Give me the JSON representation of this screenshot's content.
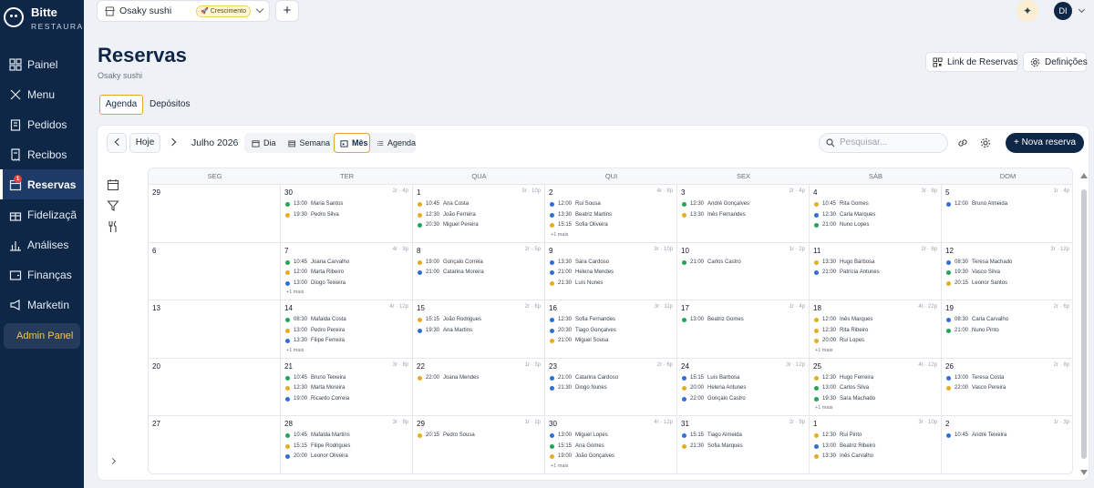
{
  "sidebar": {
    "brand": "Bitte",
    "brand_sub": "RESTAURA",
    "items": [
      {
        "label": "Painel",
        "icon": "grid-icon"
      },
      {
        "label": "Menu",
        "icon": "utensils-icon"
      },
      {
        "label": "Pedidos",
        "icon": "clipboard-icon"
      },
      {
        "label": "Recibos",
        "icon": "receipt-icon"
      },
      {
        "label": "Reservas",
        "icon": "calendar-icon",
        "badge": "1"
      },
      {
        "label": "Fidelizaçã",
        "icon": "gift-icon"
      },
      {
        "label": "Análises",
        "icon": "bar-chart-icon"
      },
      {
        "label": "Finanças",
        "icon": "wallet-icon"
      },
      {
        "label": "Marketin",
        "icon": "megaphone-icon"
      }
    ],
    "admin_label": "Admin Panel"
  },
  "topbar": {
    "restaurant": "Osaky sushi",
    "plan_badge": "🚀 Crescimento",
    "add_label": "+",
    "avatar": "DI"
  },
  "header": {
    "title": "Reservas",
    "subtitle": "Osaky sushi",
    "link_label": "Link de Reservas",
    "settings_label": "Definições"
  },
  "tabs": [
    {
      "label": "Agenda",
      "active": true
    },
    {
      "label": "Depósitos",
      "active": false
    }
  ],
  "toolbar": {
    "today": "Hoje",
    "month": "Julho 2026",
    "views": [
      {
        "label": "Dia",
        "active": false
      },
      {
        "label": "Semana",
        "active": false
      },
      {
        "label": "Mês",
        "active": true
      },
      {
        "label": "Agenda",
        "active": false
      }
    ],
    "search_placeholder": "Pesquisar...",
    "new_label": "+ Nova reserva"
  },
  "colors": {
    "green": "#22a55a",
    "blue": "#2f6fd6",
    "yellow": "#e6ad1e",
    "navy": "#0f2747"
  },
  "weekdays": [
    "SEG",
    "TER",
    "QUA",
    "QUI",
    "SEX",
    "SÁB",
    "DOM"
  ],
  "weeks": [
    [
      {
        "day": "29",
        "sum": "",
        "events": []
      },
      {
        "day": "30",
        "sum": "2r · 4p",
        "events": [
          {
            "t": "13:00",
            "n": "Maria Santos",
            "c": "green"
          },
          {
            "t": "19:30",
            "n": "Pedro Silva",
            "c": "yellow"
          }
        ]
      },
      {
        "day": "1",
        "sum": "3r · 10p",
        "events": [
          {
            "t": "10:45",
            "n": "Ana Costa",
            "c": "yellow"
          },
          {
            "t": "12:30",
            "n": "João Ferreira",
            "c": "yellow"
          },
          {
            "t": "20:30",
            "n": "Miguel Pereira",
            "c": "green"
          }
        ]
      },
      {
        "day": "2",
        "sum": "4r · 8p",
        "events": [
          {
            "t": "12:00",
            "n": "Rui Sousa",
            "c": "blue"
          },
          {
            "t": "13:30",
            "n": "Beatriz Martins",
            "c": "blue"
          },
          {
            "t": "15:15",
            "n": "Sofia Oliveira",
            "c": "yellow"
          }
        ],
        "more": "+1 mais"
      },
      {
        "day": "3",
        "sum": "2r · 4p",
        "events": [
          {
            "t": "12:30",
            "n": "André Gonçalves",
            "c": "green"
          },
          {
            "t": "13:30",
            "n": "Inês Fernandes",
            "c": "yellow"
          }
        ]
      },
      {
        "day": "4",
        "sum": "3r · 8p",
        "events": [
          {
            "t": "10:45",
            "n": "Rita Gomes",
            "c": "yellow"
          },
          {
            "t": "12:30",
            "n": "Carla Marques",
            "c": "blue"
          },
          {
            "t": "21:00",
            "n": "Nuno Lopes",
            "c": "green"
          }
        ]
      },
      {
        "day": "5",
        "sum": "1r · 4p",
        "events": [
          {
            "t": "12:00",
            "n": "Bruno Almeida",
            "c": "blue"
          }
        ]
      }
    ],
    [
      {
        "day": "6",
        "sum": "",
        "events": []
      },
      {
        "day": "7",
        "sum": "4r · 9p",
        "events": [
          {
            "t": "10:45",
            "n": "Joana Carvalho",
            "c": "green"
          },
          {
            "t": "12:00",
            "n": "Marta Ribeiro",
            "c": "yellow"
          },
          {
            "t": "13:00",
            "n": "Diogo Teixeira",
            "c": "blue"
          }
        ],
        "more": "+1 mais"
      },
      {
        "day": "8",
        "sum": "2r · 5p",
        "events": [
          {
            "t": "19:00",
            "n": "Gonçalo Correia",
            "c": "yellow"
          },
          {
            "t": "21:00",
            "n": "Catarina Moreira",
            "c": "blue"
          }
        ]
      },
      {
        "day": "9",
        "sum": "3r · 10p",
        "events": [
          {
            "t": "13:30",
            "n": "Sara Cardoso",
            "c": "blue"
          },
          {
            "t": "21:00",
            "n": "Helena Mendes",
            "c": "blue"
          },
          {
            "t": "21:30",
            "n": "Luís Nunes",
            "c": "yellow"
          }
        ]
      },
      {
        "day": "10",
        "sum": "1r · 2p",
        "events": [
          {
            "t": "21:00",
            "n": "Carlos Castro",
            "c": "green"
          }
        ]
      },
      {
        "day": "11",
        "sum": "2r · 6p",
        "events": [
          {
            "t": "13:30",
            "n": "Hugo Barbosa",
            "c": "yellow"
          },
          {
            "t": "21:00",
            "n": "Patrícia Antunes",
            "c": "blue"
          }
        ]
      },
      {
        "day": "12",
        "sum": "3r · 12p",
        "events": [
          {
            "t": "08:30",
            "n": "Teresa Machado",
            "c": "blue"
          },
          {
            "t": "19:30",
            "n": "Vasco Silva",
            "c": "green"
          },
          {
            "t": "20:15",
            "n": "Leonor Santos",
            "c": "yellow"
          }
        ]
      }
    ],
    [
      {
        "day": "13",
        "sum": "",
        "events": []
      },
      {
        "day": "14",
        "sum": "4r · 12p",
        "events": [
          {
            "t": "08:30",
            "n": "Mafalda Costa",
            "c": "green"
          },
          {
            "t": "13:00",
            "n": "Pedro Pereira",
            "c": "yellow"
          },
          {
            "t": "13:30",
            "n": "Filipe Ferreira",
            "c": "blue"
          }
        ],
        "more": "+1 mais"
      },
      {
        "day": "15",
        "sum": "2r · 6p",
        "events": [
          {
            "t": "15:15",
            "n": "João Rodrigues",
            "c": "yellow"
          },
          {
            "t": "19:30",
            "n": "Ana Martins",
            "c": "blue"
          }
        ]
      },
      {
        "day": "16",
        "sum": "3r · 11p",
        "events": [
          {
            "t": "12:30",
            "n": "Sofia Fernandes",
            "c": "blue"
          },
          {
            "t": "20:30",
            "n": "Tiago Gonçalves",
            "c": "blue"
          },
          {
            "t": "21:00",
            "n": "Miguel Sousa",
            "c": "yellow"
          }
        ]
      },
      {
        "day": "17",
        "sum": "1r · 4p",
        "events": [
          {
            "t": "13:00",
            "n": "Beatriz Gomes",
            "c": "green"
          }
        ]
      },
      {
        "day": "18",
        "sum": "4r · 22p",
        "events": [
          {
            "t": "12:00",
            "n": "Inês Marques",
            "c": "yellow"
          },
          {
            "t": "12:30",
            "n": "Rita Ribeiro",
            "c": "yellow"
          },
          {
            "t": "20:00",
            "n": "Rui Lopes",
            "c": "yellow"
          }
        ],
        "more": "+1 mais"
      },
      {
        "day": "19",
        "sum": "2r · 6p",
        "events": [
          {
            "t": "08:30",
            "n": "Carla Carvalho",
            "c": "blue"
          },
          {
            "t": "21:00",
            "n": "Nuno Pinto",
            "c": "green"
          }
        ]
      }
    ],
    [
      {
        "day": "20",
        "sum": "",
        "events": []
      },
      {
        "day": "21",
        "sum": "3r · 8p",
        "events": [
          {
            "t": "10:45",
            "n": "Bruno Teixeira",
            "c": "green"
          },
          {
            "t": "12:30",
            "n": "Marta Moreira",
            "c": "yellow"
          },
          {
            "t": "19:00",
            "n": "Ricardo Correia",
            "c": "blue"
          }
        ]
      },
      {
        "day": "22",
        "sum": "1r · 3p",
        "events": [
          {
            "t": "22:00",
            "n": "Joana Mendes",
            "c": "yellow"
          }
        ]
      },
      {
        "day": "23",
        "sum": "2r · 6p",
        "events": [
          {
            "t": "21:00",
            "n": "Catarina Cardoso",
            "c": "blue"
          },
          {
            "t": "21:30",
            "n": "Diogo Nunes",
            "c": "blue"
          }
        ]
      },
      {
        "day": "24",
        "sum": "3r · 12p",
        "events": [
          {
            "t": "15:15",
            "n": "Luís Barbosa",
            "c": "blue"
          },
          {
            "t": "20:00",
            "n": "Helena Antunes",
            "c": "yellow"
          },
          {
            "t": "22:00",
            "n": "Gonçalo Castro",
            "c": "blue"
          }
        ]
      },
      {
        "day": "25",
        "sum": "4r · 12p",
        "events": [
          {
            "t": "12:30",
            "n": "Hugo Ferreira",
            "c": "yellow"
          },
          {
            "t": "13:00",
            "n": "Carlos Silva",
            "c": "green"
          },
          {
            "t": "19:30",
            "n": "Sara Machado",
            "c": "green"
          }
        ],
        "more": "+1 mais"
      },
      {
        "day": "26",
        "sum": "2r · 8p",
        "events": [
          {
            "t": "13:00",
            "n": "Teresa Costa",
            "c": "blue"
          },
          {
            "t": "22:00",
            "n": "Vasco Pereira",
            "c": "yellow"
          }
        ]
      }
    ],
    [
      {
        "day": "27",
        "sum": "",
        "events": []
      },
      {
        "day": "28",
        "sum": "3r · 9p",
        "events": [
          {
            "t": "10:45",
            "n": "Mafalda Martins",
            "c": "green"
          },
          {
            "t": "15:15",
            "n": "Filipe Rodrigues",
            "c": "yellow"
          },
          {
            "t": "20:00",
            "n": "Leonor Oliveira",
            "c": "blue"
          }
        ]
      },
      {
        "day": "29",
        "sum": "1r · 2p",
        "events": [
          {
            "t": "20:15",
            "n": "Pedro Sousa",
            "c": "yellow"
          }
        ]
      },
      {
        "day": "30",
        "sum": "4r · 12p",
        "events": [
          {
            "t": "13:00",
            "n": "Miguel Lopes",
            "c": "blue"
          },
          {
            "t": "15:15",
            "n": "Ana Gomes",
            "c": "green"
          },
          {
            "t": "19:00",
            "n": "João Gonçalves",
            "c": "yellow"
          }
        ],
        "more": "+1 mais"
      },
      {
        "day": "31",
        "sum": "2r · 9p",
        "events": [
          {
            "t": "15:15",
            "n": "Tiago Almeida",
            "c": "blue"
          },
          {
            "t": "21:30",
            "n": "Sofia Marques",
            "c": "yellow"
          }
        ]
      },
      {
        "day": "1",
        "sum": "3r · 10p",
        "events": [
          {
            "t": "12:30",
            "n": "Rui Pinto",
            "c": "yellow"
          },
          {
            "t": "13:00",
            "n": "Beatriz Ribeiro",
            "c": "blue"
          },
          {
            "t": "13:30",
            "n": "Inês Carvalho",
            "c": "yellow"
          }
        ]
      },
      {
        "day": "2",
        "sum": "1r · 3p",
        "events": [
          {
            "t": "10:45",
            "n": "André Teixeira",
            "c": "blue"
          }
        ]
      }
    ]
  ]
}
